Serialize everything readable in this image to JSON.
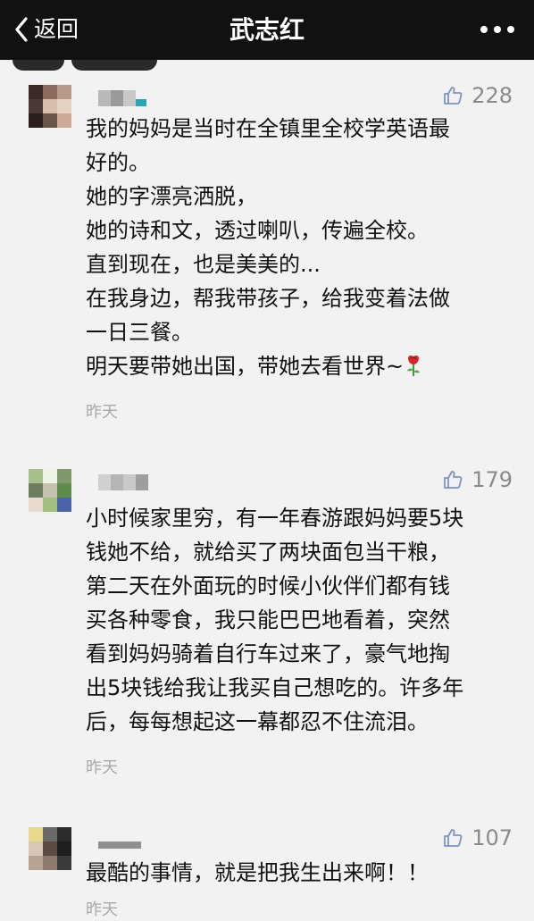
{
  "navbar": {
    "back_label": "返回",
    "title": "武志红",
    "back_icon": "chevron-left-icon",
    "more_icon": "more-dots-icon"
  },
  "comments": [
    {
      "likes": "228",
      "text": "我的妈妈是当时在全镇里全校学英语最\n好的。\n她的字漂亮洒脱，\n她的诗和文，透过喇叭，传遍全校。\n直到现在，也是美美的...\n在我身边，帮我带孩子，给我变着法做\n一日三餐。\n明天要带她出国，带她去看世界~",
      "emoji": "rose-icon",
      "time": "昨天",
      "avatar_colors": [
        "#3b2a24",
        "#8a6b5c",
        "#b89a88",
        "#4a3a33",
        "#d8c0ad",
        "#e6d2c1",
        "#2a1f1b",
        "#6b544a",
        "#c9ab96"
      ]
    },
    {
      "likes": "179",
      "text": "小时候家里穷，有一年春游跟妈妈要5块\n钱她不给，就给买了两块面包当干粮，\n第二天在外面玩的时候小伙伴们都有钱\n买各种零食，我只能巴巴地看着，突然\n看到妈妈骑着自行车过来了，豪气地掏\n出5块钱给我让我买自己想吃的。许多年\n后，每每想起这一幕都忍不住流泪。",
      "time": "昨天",
      "avatar_colors": [
        "#a6c08a",
        "#eef3e6",
        "#7e9a6a",
        "#6d7d5e",
        "#c6c2b0",
        "#5f8a50",
        "#e8d9cf",
        "#9fc07e",
        "#4c63a8"
      ]
    },
    {
      "likes": "107",
      "text": "最酷的事情，就是把我生出来啊！！",
      "time": "昨天",
      "avatar_colors": [
        "#e8d98a",
        "#6a6a6a",
        "#2c2c2c",
        "#d9c7b5",
        "#5a4a42",
        "#1e1e1e",
        "#b8a392",
        "#8d7a6d",
        "#3a3a3a"
      ]
    }
  ],
  "colors": {
    "navbar_bg": "#111111",
    "page_bg": "#f2f2f2",
    "text": "#111111",
    "muted": "#8a8a8a",
    "time": "#a9a9a9"
  }
}
